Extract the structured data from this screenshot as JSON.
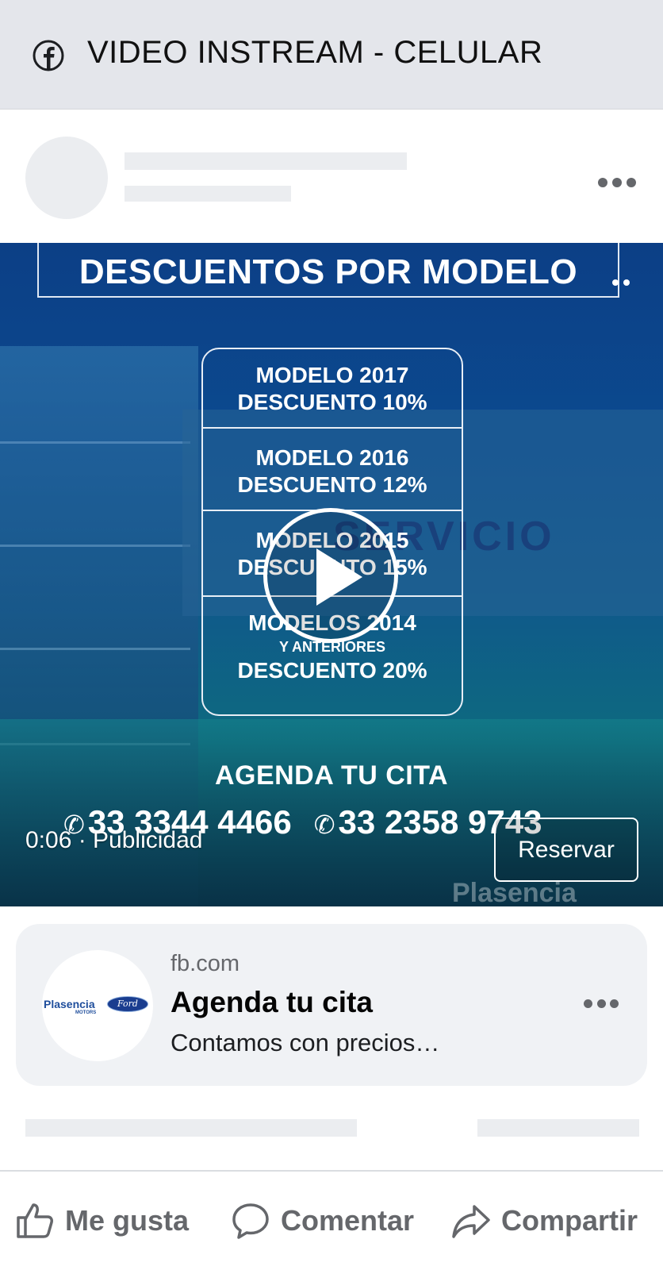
{
  "header": {
    "title": "VIDEO INSTREAM - CELULAR",
    "icon": "facebook-icon"
  },
  "post_header": {
    "avatar": "placeholder",
    "menu_icon": "more-horizontal-icon"
  },
  "video": {
    "headline": "DESCUENTOS POR MODELO",
    "discounts": [
      {
        "model": "MODELO 2017",
        "discount": "DESCUENTO 10%"
      },
      {
        "model": "MODELO 2016",
        "discount": "DESCUENTO 12%"
      },
      {
        "model": "MODELO 2015",
        "discount": "DESCUENTO 15%"
      },
      {
        "model": "MODELOS 2014",
        "note": "Y ANTERIORES",
        "discount": "DESCUENTO 20%"
      }
    ],
    "background_sign": "SERVICIO",
    "cta_text": "AGENDA TU CITA",
    "phone_1": "33 3344 4466",
    "phone_2": "33 2358 9743",
    "time_label": "0:06 · Publicidad",
    "reserve_button": "Reservar",
    "watermark": "Plasencia"
  },
  "link_card": {
    "domain": "fb.com",
    "title": "Agenda tu cita",
    "description": "Contamos con precios…",
    "logo_text": "Plasencia",
    "logo_sub": "MOTORS",
    "logo_badge": "Ford"
  },
  "actions": {
    "like": "Me gusta",
    "comment": "Comentar",
    "share": "Compartir"
  },
  "colors": {
    "topbar_bg": "#e4e6eb",
    "card_bg": "#f0f2f5",
    "action_text": "#65676b",
    "video_blue": "#0c3f86"
  }
}
